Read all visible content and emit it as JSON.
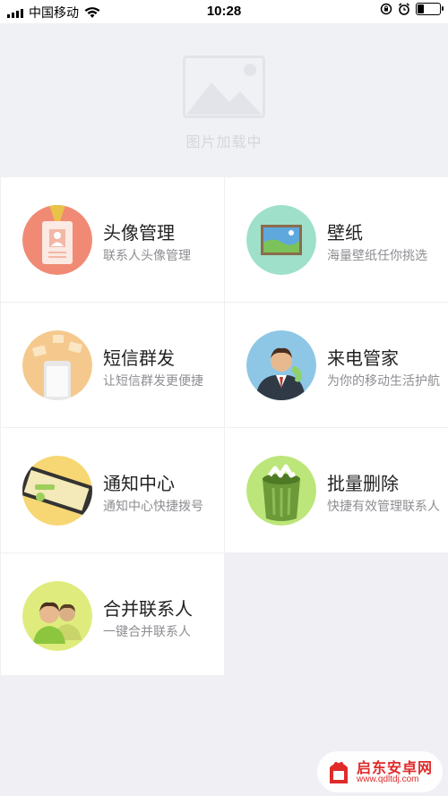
{
  "status_bar": {
    "carrier": "中国移动",
    "time": "10:28",
    "battery_level": 0.25,
    "icons": [
      "signal-icon",
      "wifi-icon",
      "rotation-lock-icon",
      "alarm-icon",
      "battery-icon"
    ]
  },
  "banner": {
    "placeholder_text": "图片加载中",
    "icon": "image-placeholder-icon"
  },
  "features": [
    {
      "title": "头像管理",
      "subtitle": "联系人头像管理",
      "icon": "contact-badge-icon",
      "color": "#f08a74"
    },
    {
      "title": "壁纸",
      "subtitle": "海量壁纸任你挑选",
      "icon": "wallpaper-icon",
      "color": "#9fe0cb"
    },
    {
      "title": "短信群发",
      "subtitle": "让短信群发更便捷",
      "icon": "sms-phone-icon",
      "color": "#f5c98e"
    },
    {
      "title": "来电管家",
      "subtitle": "为你的移动生活护航",
      "icon": "caller-icon",
      "color": "#8ec7e6"
    },
    {
      "title": "通知中心",
      "subtitle": "通知中心快捷拨号",
      "icon": "notification-phone-icon",
      "color": "#f7d774"
    },
    {
      "title": "批量删除",
      "subtitle": "快捷有效管理联系人",
      "icon": "trash-bin-icon",
      "color": "#bce67a"
    },
    {
      "title": "合并联系人",
      "subtitle": "一键合并联系人",
      "icon": "merge-contacts-icon",
      "color": "#dfec7d"
    }
  ],
  "watermark": {
    "brand": "启东安卓网",
    "url": "www.qdltdj.com"
  }
}
